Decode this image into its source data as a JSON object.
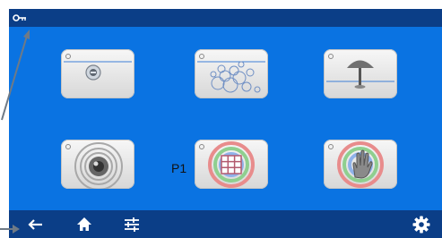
{
  "topbar": {
    "icon": "key-icon"
  },
  "program": {
    "label": "P1"
  },
  "tiles": [
    {
      "icon": "lens-button-icon"
    },
    {
      "icon": "bubbles-icon"
    },
    {
      "icon": "mushroom-icon"
    },
    {
      "icon": "concentric-rings-icon"
    },
    {
      "icon": "colored-grid-icon"
    },
    {
      "icon": "hand-icon"
    }
  ],
  "bottombar": {
    "icons": [
      "back-arrow-icon",
      "home-icon",
      "sliders-icon",
      "settings-gear-icon"
    ]
  },
  "colors": {
    "screen": "#0a73e2",
    "bars": "#0b3e87",
    "pointer": "#6f7a86"
  }
}
